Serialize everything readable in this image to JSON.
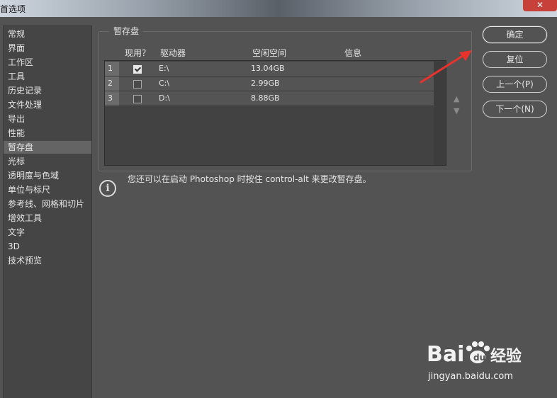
{
  "window": {
    "title": "首选项",
    "close_glyph": "✕"
  },
  "sidebar": {
    "items": [
      {
        "label": "常规"
      },
      {
        "label": "界面"
      },
      {
        "label": "工作区"
      },
      {
        "label": "工具"
      },
      {
        "label": "历史记录"
      },
      {
        "label": "文件处理"
      },
      {
        "label": "导出"
      },
      {
        "label": "性能"
      },
      {
        "label": "暂存盘",
        "selected": true
      },
      {
        "label": "光标"
      },
      {
        "label": "透明度与色域"
      },
      {
        "label": "单位与标尺"
      },
      {
        "label": "参考线、网格和切片"
      },
      {
        "label": "增效工具"
      },
      {
        "label": "文字"
      },
      {
        "label": "3D"
      },
      {
        "label": "技术预览"
      }
    ]
  },
  "scratch": {
    "group_title": "暂存盘",
    "columns": {
      "active": "现用？",
      "drive": "驱动器",
      "free_space": "空闲空间",
      "info": "信息"
    },
    "rows": [
      {
        "num": "1",
        "active": true,
        "drive": "E:\\",
        "free": "13.04GB",
        "info": ""
      },
      {
        "num": "2",
        "active": false,
        "drive": "C:\\",
        "free": "2.99GB",
        "info": ""
      },
      {
        "num": "3",
        "active": false,
        "drive": "D:\\",
        "free": "8.88GB",
        "info": ""
      }
    ],
    "up_glyph": "▲",
    "down_glyph": "▼"
  },
  "info": {
    "icon": "info-icon",
    "text": "您还可以在启动 Photoshop 时按住 control-alt 来更改暂存盘。"
  },
  "buttons": {
    "ok": "确定",
    "reset": "复位",
    "prev": "上一个(P)",
    "next": "下一个(N)"
  },
  "watermark": {
    "brand": "Bai",
    "brand2": "经验",
    "url": "jingyan.baidu.com"
  },
  "colors": {
    "annotation_arrow": "#e8322c",
    "panel_bg": "#535353",
    "selected_item": "#646464"
  }
}
